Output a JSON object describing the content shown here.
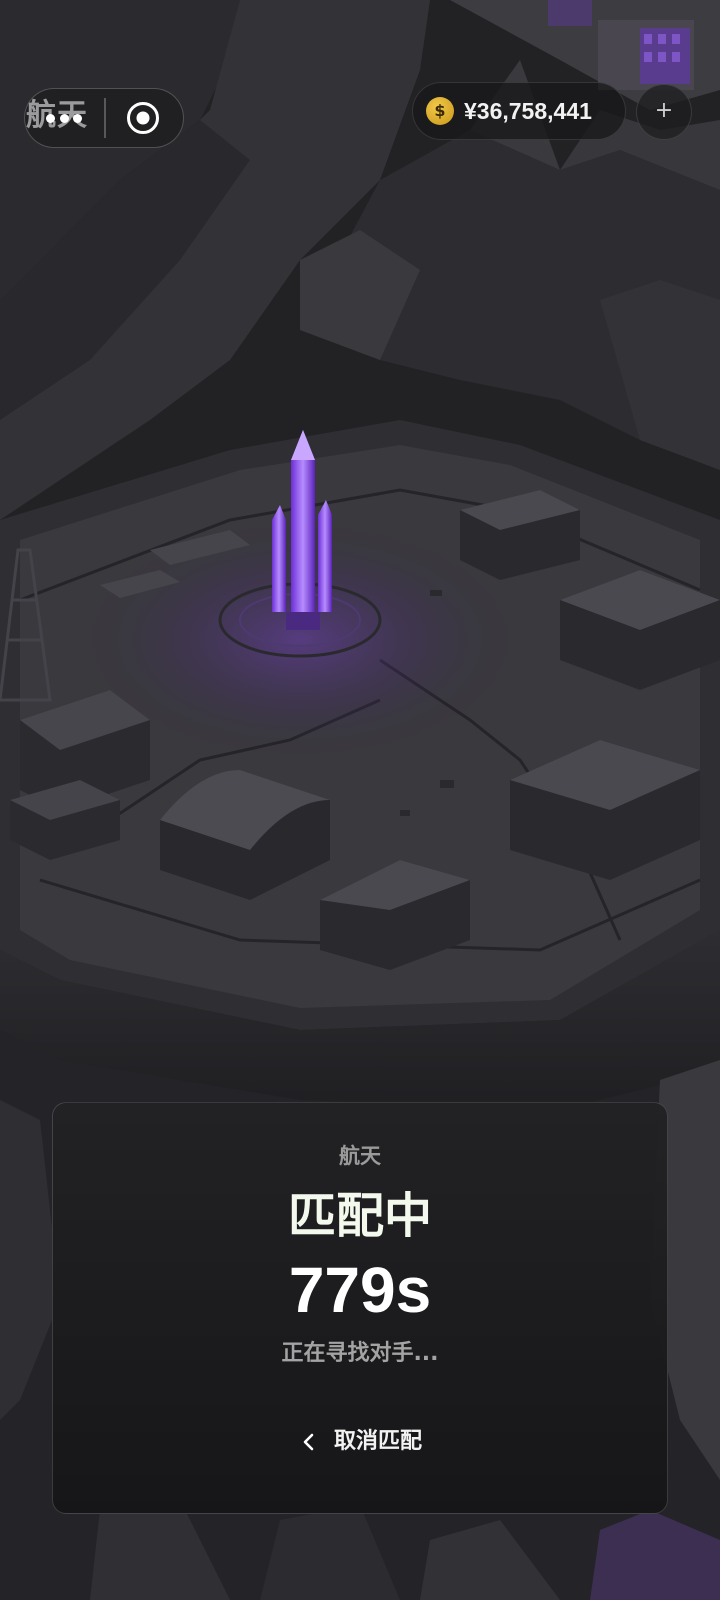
{
  "header": {
    "title": "航天",
    "more_icon": "more-dots-icon",
    "record_icon": "record-circle-icon"
  },
  "currency": {
    "icon": "dollar-coin-icon",
    "amount": "¥36,758,441",
    "add_label": "+"
  },
  "match_panel": {
    "mode": "航天",
    "status": "匹配中",
    "timer": "779s",
    "hint": "正在寻找对手...",
    "cancel_label": "取消匹配",
    "cancel_icon": "chevron-left-icon"
  },
  "colors": {
    "background": "#1b1b1d",
    "accent_purple": "#8a4dff",
    "coin_gold": "#e8b21f",
    "status_text": "#f3f9ec"
  }
}
